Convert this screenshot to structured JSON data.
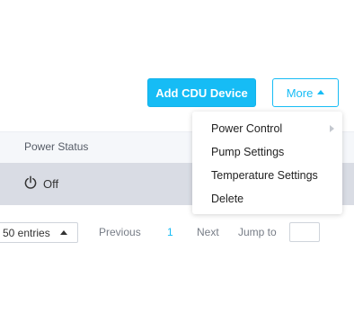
{
  "toolbar": {
    "add_button_label": "Add CDU Device",
    "more_button_label": "More"
  },
  "table": {
    "columns": [
      "Power Status"
    ],
    "rows": [
      {
        "power_status": "Off"
      }
    ]
  },
  "pagination": {
    "page_size": "50 entries",
    "previous_label": "Previous",
    "current_page": "1",
    "next_label": "Next",
    "jump_label": "Jump to",
    "jump_value": ""
  },
  "more_menu": {
    "items": [
      {
        "label": "Power Control",
        "has_submenu": true
      },
      {
        "label": "Pump Settings"
      },
      {
        "label": "Temperature Settings"
      },
      {
        "label": "Delete"
      }
    ]
  },
  "colors": {
    "accent": "#16bcf5",
    "header_bg": "#f5f7fa",
    "selected_row_bg": "#d9dce4"
  }
}
